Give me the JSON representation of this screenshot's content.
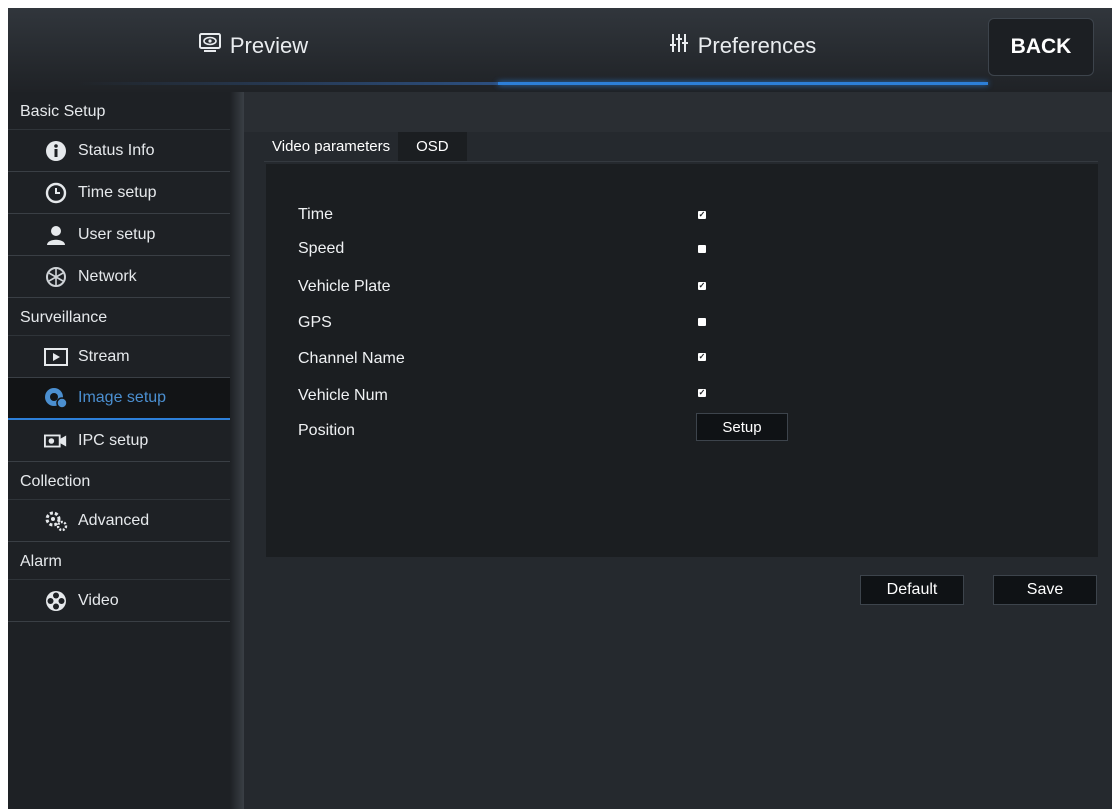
{
  "topbar": {
    "preview_label": "Preview",
    "preferences_label": "Preferences",
    "back_label": "BACK",
    "preview_icon": "monitor-eye-icon",
    "preferences_icon": "sliders-icon",
    "accent_color": "#2d7fd8"
  },
  "sidebar": {
    "sections": [
      {
        "title": "Basic Setup",
        "items": [
          {
            "label": "Status Info",
            "icon": "info-icon"
          },
          {
            "label": "Time setup",
            "icon": "clock-icon"
          },
          {
            "label": "User setup",
            "icon": "user-icon"
          },
          {
            "label": "Network",
            "icon": "network-globe-icon"
          }
        ]
      },
      {
        "title": "Surveillance",
        "items": [
          {
            "label": "Stream",
            "icon": "play-stream-icon"
          },
          {
            "label": "Image setup",
            "icon": "image-setup-icon",
            "active": true
          },
          {
            "label": "IPC setup",
            "icon": "ipc-camera-icon"
          }
        ]
      },
      {
        "title": "Collection",
        "items": [
          {
            "label": "Advanced",
            "icon": "gears-icon"
          }
        ]
      },
      {
        "title": "Alarm",
        "items": [
          {
            "label": "Video",
            "icon": "film-reel-icon"
          }
        ]
      }
    ]
  },
  "tabs": [
    {
      "label": "Video parameters",
      "active": true
    },
    {
      "label": "OSD",
      "active": false
    }
  ],
  "osd_options": [
    {
      "label": "Time",
      "checked": true
    },
    {
      "label": "Speed",
      "checked": false
    },
    {
      "label": "Vehicle Plate",
      "checked": true
    },
    {
      "label": "GPS",
      "checked": false
    },
    {
      "label": "Channel Name",
      "checked": true
    },
    {
      "label": "Vehicle Num",
      "checked": true
    }
  ],
  "position": {
    "label": "Position",
    "button_label": "Setup"
  },
  "actions": {
    "default_label": "Default",
    "save_label": "Save"
  }
}
